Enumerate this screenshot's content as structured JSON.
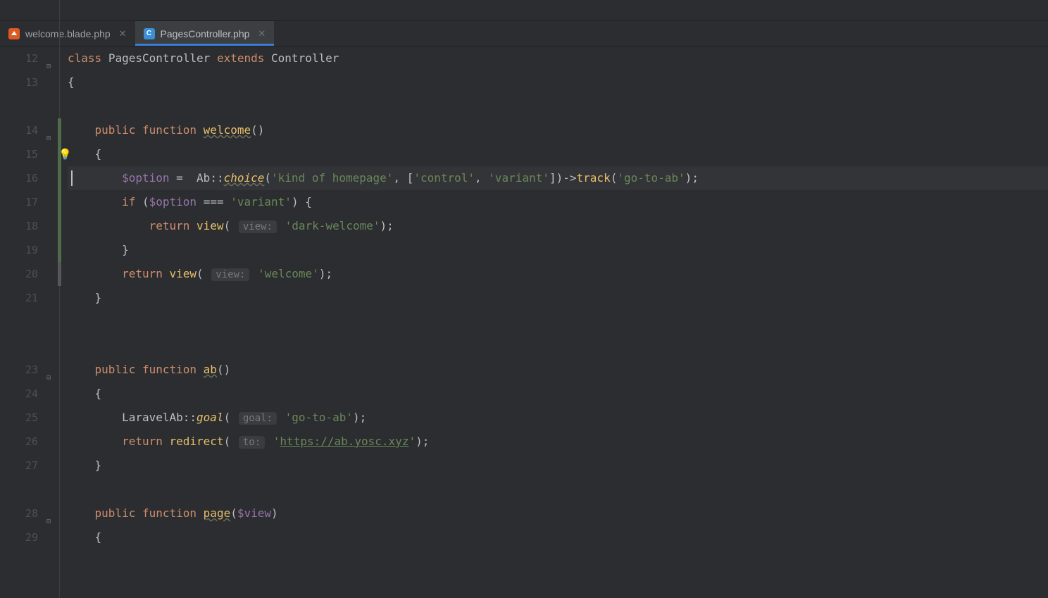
{
  "tabs": [
    {
      "label": "welcome.blade.php",
      "active": false,
      "icon": "blade"
    },
    {
      "label": "PagesController.php",
      "active": true,
      "icon": "php",
      "iconLetter": "C"
    }
  ],
  "gutter": {
    "start": 12,
    "lines": [
      "12",
      "13",
      "",
      "14",
      "15",
      "16",
      "17",
      "18",
      "19",
      "20",
      "21",
      "",
      "",
      "23",
      "24",
      "25",
      "26",
      "27",
      "",
      "28",
      "29"
    ]
  },
  "code": {
    "l12": {
      "kw_class": "class",
      "cls": "PagesController",
      "kw_ext": "extends",
      "base": "Controller"
    },
    "l13": {
      "brace": "{"
    },
    "l14": {
      "kw_pub": "public",
      "kw_fn": "function",
      "name": "welcome",
      "args": "()"
    },
    "l15": {
      "brace": "{"
    },
    "l16": {
      "var": "$option",
      "eq": "=",
      "cls": "Ab",
      "dcolon": "::",
      "method": "choice",
      "p1": "(",
      "s1": "'kind of homepage'",
      "c1": ", ",
      "br1": "[",
      "s2": "'control'",
      "c2": ", ",
      "s3": "'variant'",
      "br2": "]",
      "p2": ")",
      "arrow": "->",
      "track": "track",
      "p3": "(",
      "s4": "'go-to-ab'",
      "p4": ")",
      "semi": ";"
    },
    "l17": {
      "kw_if": "if",
      "p1": "(",
      "var": "$option",
      "op": "===",
      "s1": "'variant'",
      "p2": ")",
      "brace": "{"
    },
    "l18": {
      "kw_ret": "return",
      "fn": "view",
      "p1": "(",
      "hint": "view:",
      "s1": "'dark-welcome'",
      "p2": ")",
      "semi": ";"
    },
    "l19": {
      "brace": "}"
    },
    "l20": {
      "kw_ret": "return",
      "fn": "view",
      "p1": "(",
      "hint": "view:",
      "s1": "'welcome'",
      "p2": ")",
      "semi": ";"
    },
    "l21": {
      "brace": "}"
    },
    "l23": {
      "kw_pub": "public",
      "kw_fn": "function",
      "name": "ab",
      "args": "()"
    },
    "l24": {
      "brace": "{"
    },
    "l25": {
      "cls": "LaravelAb",
      "dcolon": "::",
      "method": "goal",
      "p1": "(",
      "hint": "goal:",
      "s1": "'go-to-ab'",
      "p2": ")",
      "semi": ";"
    },
    "l26": {
      "kw_ret": "return",
      "fn": "redirect",
      "p1": "(",
      "hint": "to:",
      "s1": "'",
      "url": "https://ab.yosc.xyz",
      "s2": "'",
      "p2": ")",
      "semi": ";"
    },
    "l27": {
      "brace": "}"
    },
    "l28": {
      "kw_pub": "public",
      "kw_fn": "function",
      "name": "page",
      "p1": "(",
      "var": "$view",
      "p2": ")"
    },
    "l29": {
      "brace": "{"
    }
  }
}
